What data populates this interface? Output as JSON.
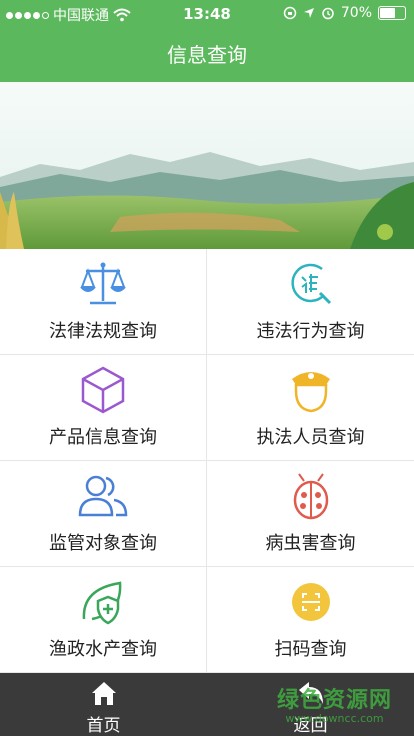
{
  "status_bar": {
    "carrier": "中国联通",
    "time": "13:48",
    "battery": "70%",
    "battery_level": 0.7
  },
  "header": {
    "title": "信息查询"
  },
  "menu": [
    {
      "label": "法律法规查询",
      "icon": "scales-icon",
      "color": "#4a90e2"
    },
    {
      "label": "违法行为查询",
      "icon": "violation-search-icon",
      "color": "#2bb3c0"
    },
    {
      "label": "产品信息查询",
      "icon": "cube-icon",
      "color": "#9b59d0"
    },
    {
      "label": "执法人员查询",
      "icon": "officer-icon",
      "color": "#f0b429"
    },
    {
      "label": "监管对象查询",
      "icon": "users-icon",
      "color": "#4a7fd6"
    },
    {
      "label": "病虫害查询",
      "icon": "ladybug-icon",
      "color": "#e05a4e"
    },
    {
      "label": "渔政水产查询",
      "icon": "leaf-shield-icon",
      "color": "#3aa65a"
    },
    {
      "label": "扫码查询",
      "icon": "scan-icon",
      "color": "#f2c53d"
    }
  ],
  "tabbar": {
    "home_label": "首页",
    "back_label": "返回"
  },
  "watermark": {
    "main": "绿色资源网",
    "url": "www.downcc.com"
  }
}
